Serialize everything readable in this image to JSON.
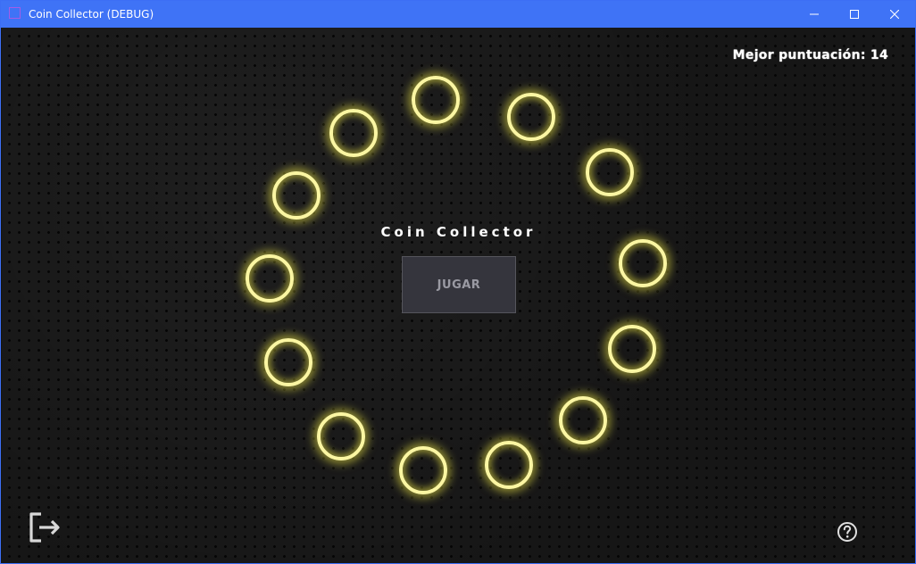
{
  "window": {
    "title": "Coin Collector (DEBUG)",
    "controls": {
      "minimize_icon": "minimize-icon",
      "maximize_icon": "maximize-icon",
      "close_icon": "close-icon"
    },
    "titlebar_color": "#3f73f6"
  },
  "game": {
    "best_score": "Mejor puntuación: 14",
    "title": "Coin Collector",
    "play_button": "JUGAR",
    "ring_color": "#fbf6a2",
    "ring_glow_color": "#ece646",
    "exit_icon": "exit-icon",
    "help_icon": "help-icon"
  }
}
